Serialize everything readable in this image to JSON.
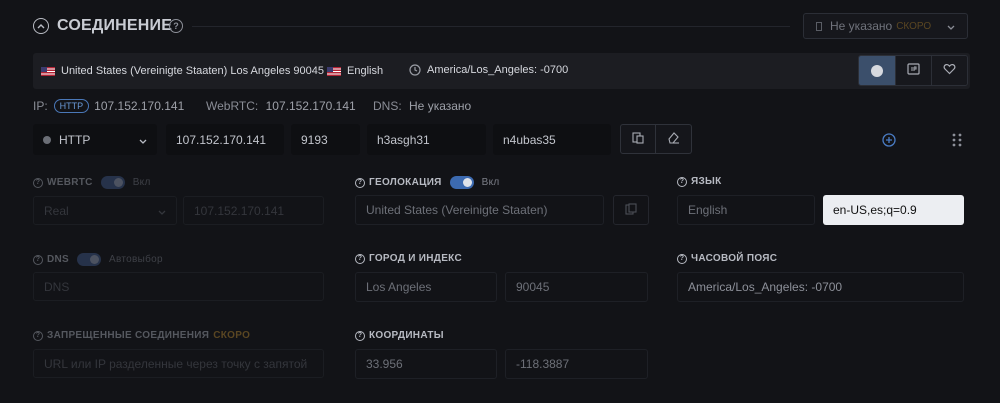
{
  "header": {
    "title": "СОЕДИНЕНИЕ",
    "select_label": "Не указано",
    "select_badge": "СКОРО"
  },
  "infobar": {
    "location": "United States (Vereinigte Staaten) Los Angeles 90045",
    "language": "English",
    "timezone": "America/Los_Angeles: -0700"
  },
  "status": {
    "ip_label": "IP:",
    "ip_proto": "HTTP",
    "ip_value": "107.152.170.141",
    "webrtc_label": "WebRTC:",
    "webrtc_value": "107.152.170.141",
    "dns_label": "DNS:",
    "dns_value": "Не указано"
  },
  "proxy": {
    "type": "HTTP",
    "host": "107.152.170.141",
    "port": "9193",
    "login": "h3asgh31",
    "password": "n4ubas35"
  },
  "webrtc": {
    "label": "WEBRTC",
    "toggle_text": "Вкл",
    "mode": "Real",
    "ip": "107.152.170.141"
  },
  "geo": {
    "label": "ГЕОЛОКАЦИЯ",
    "toggle_text": "Вкл",
    "country": "United States (Vereinigte Staaten)"
  },
  "lang": {
    "label": "ЯЗЫК",
    "name": "English",
    "code": "en-US,es;q=0.9"
  },
  "dns": {
    "label": "DNS",
    "toggle_text": "Автовыбор",
    "placeholder": "DNS"
  },
  "city": {
    "label": "ГОРОД И ИНДЕКС",
    "city": "Los Angeles",
    "zip": "90045"
  },
  "timezone": {
    "label": "ЧАСОВОЙ ПОЯС",
    "value": "America/Los_Angeles: -0700"
  },
  "blocked": {
    "label": "ЗАПРЕЩЕННЫЕ СОЕДИНЕНИЯ",
    "badge": "СКОРО",
    "placeholder": "URL или IP разделенные через точку с запятой"
  },
  "coords": {
    "label": "КООРДИНАТЫ",
    "lat": "33.956",
    "lon": "-118.3887"
  },
  "colors": {
    "accent": "#3c6ab0",
    "soon": "#e8a33a",
    "background": "#121317"
  },
  "icons": [
    "collapse-chevron-icon",
    "help-icon",
    "flag-icon",
    "clock-icon",
    "circle-icon",
    "ip-badge-icon",
    "heart-icon",
    "chevron-down-icon",
    "copy-icon",
    "eraser-icon",
    "add-icon",
    "drag-handle-icon"
  ]
}
